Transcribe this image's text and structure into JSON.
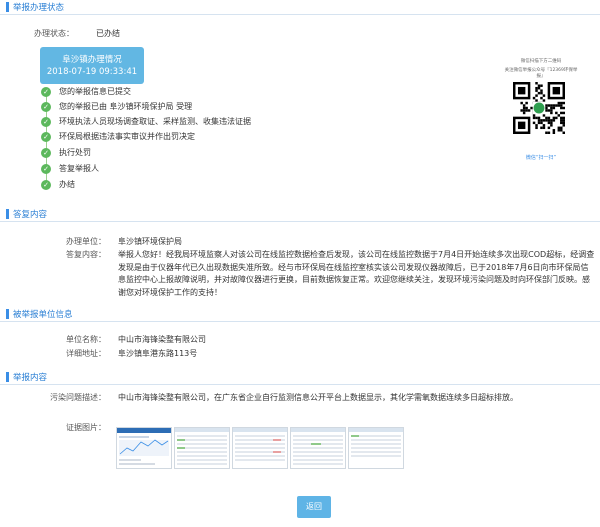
{
  "section_titles": {
    "process": "举报办理状态",
    "reply": "答复内容",
    "reported_unit": "被举报单位信息",
    "report_content": "举报内容"
  },
  "process": {
    "status_label": "办理状态：",
    "status_value": "已办结",
    "card_title": "阜沙镇办理情况",
    "card_datetime": "2018-07-19 09:33:41",
    "steps": [
      "您的举报信息已提交",
      "您的举报已由 阜沙镇环境保护局 受理",
      "环境执法人员现场调查取证、采样监测、收集违法证据",
      "环保局根据违法事实审议并作出罚决定",
      "执行处罚",
      "答复举报人",
      "办结"
    ]
  },
  "qr": {
    "caption_line1": "微信扫描下方二维码",
    "caption_line2": "关注微信举报公众号『12369环保举报』",
    "caption_bottom": "微信“扫一扫”"
  },
  "reply": {
    "unit_label": "办理单位：",
    "unit_value": "阜沙镇环境保护局",
    "content_label": "答复内容：",
    "content_value": "举报人您好！经我局环境监察人对该公司在线监控数据检查后发现，该公司在线监控数据于7月4日开始连续多次出现COD超标，经调查发现是由于仪器年代已久出现数据失准所致。经与市环保局在线监控室核实该公司发现仪器故障后，已于2018年7月6日向市环保局信息监控中心上报故障说明，并对故障仪器进行更换，目前数据恢复正常。欢迎您继续关注，发现环境污染问题及时向环保部门反映。感谢您对环境保护工作的支持！"
  },
  "reported_unit": {
    "name_label": "单位名称：",
    "name_value": "中山市海锋染整有限公司",
    "address_label": "详细地址：",
    "address_value": "阜沙镇阜港东路113号"
  },
  "report_content": {
    "desc_label": "污染问题描述：",
    "desc_value": "中山市海锋染整有限公司，在广东省企业自行监测信息公开平台上数据显示，其化学需氧数据连续多日超标排放。",
    "evidence_label": "证据图片："
  },
  "footer": {
    "back_label": "返回"
  },
  "colors": {
    "accent": "#3a8ee6",
    "card": "#62b7e3",
    "step_done": "#5cb85c",
    "button": "#5fb4e6"
  },
  "icons": {
    "step": "check-circle-icon",
    "qr": "qr-code-icon"
  }
}
